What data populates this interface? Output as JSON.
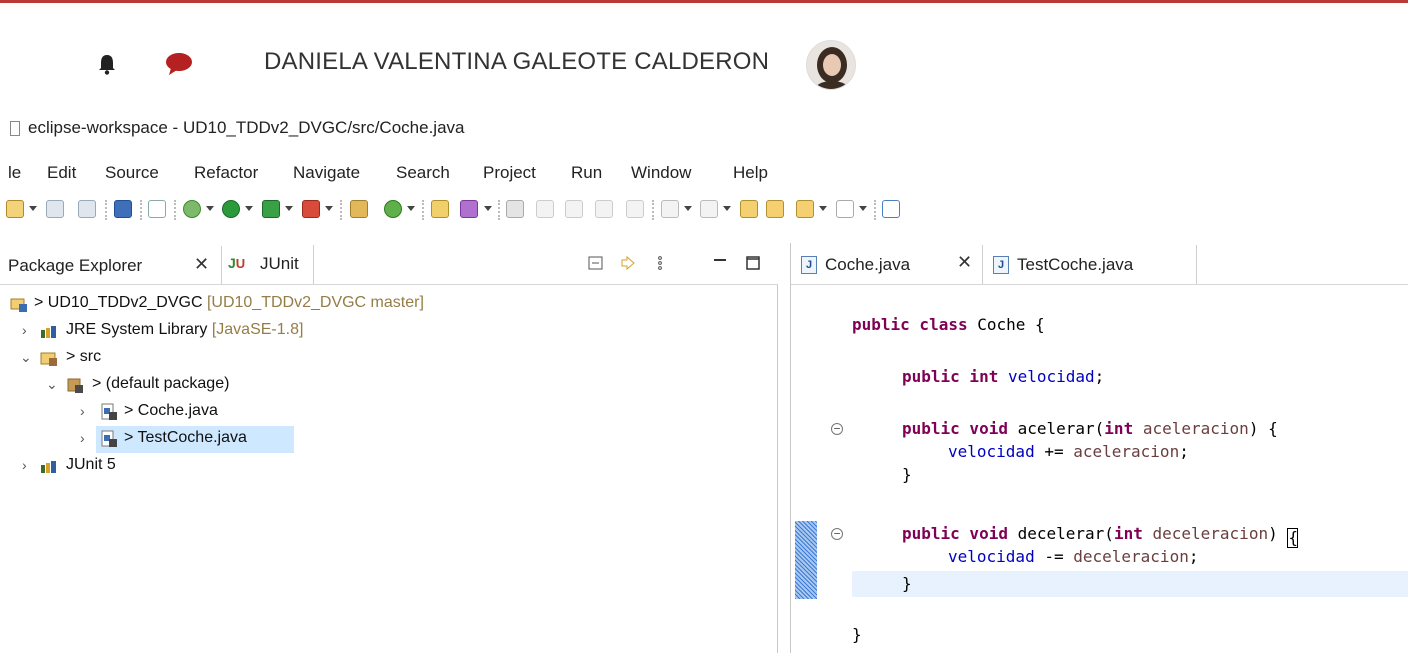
{
  "topbar": {
    "user_name": "DANIELA VALENTINA GALEOTE CALDERON",
    "accent": "#b93a36"
  },
  "window": {
    "title": "eclipse-workspace - UD10_TDDv2_DVGC/src/Coche.java"
  },
  "menu": {
    "items": [
      "le",
      "Edit",
      "Source",
      "Refactor",
      "Navigate",
      "Search",
      "Project",
      "Run",
      "Window",
      "Help"
    ]
  },
  "left_panel": {
    "tabs": [
      {
        "label": "Package Explorer",
        "close": "✕"
      },
      {
        "label": "JUnit"
      }
    ],
    "tree": [
      {
        "label": "> UD10_TDDv2_DVGC",
        "decoration": "[UD10_TDDv2_DVGC master]",
        "icon": "project-icon"
      },
      {
        "label": "JRE System Library",
        "decoration": "[JavaSE-1.8]",
        "icon": "library-icon"
      },
      {
        "label": "> src",
        "icon": "source-folder-icon"
      },
      {
        "label": "> (default package)",
        "icon": "package-icon"
      },
      {
        "label": "> Coche.java",
        "icon": "java-file-icon"
      },
      {
        "label": "> TestCoche.java",
        "icon": "java-file-icon",
        "selected": true
      },
      {
        "label": "JUnit 5",
        "icon": "library-icon"
      }
    ]
  },
  "editor": {
    "tabs": [
      {
        "label": "Coche.java",
        "close": "✕",
        "active": true
      },
      {
        "label": "TestCoche.java"
      }
    ],
    "code": {
      "l1_kw": "public class",
      "l1_rest": " Coche {",
      "l2_kw": "public int",
      "l2_field": "velocidad",
      "l2_end": ";",
      "l3_kw1": "public void",
      "l3_name": " acelerar(",
      "l3_kw2": "int",
      "l3_param": "aceleracion",
      "l3_end": ") {",
      "l4_field": "velocidad",
      "l4_op": " += ",
      "l4_param": "aceleracion",
      "l4_end": ";",
      "l5": "}",
      "l6_kw1": "public void",
      "l6_name": " decelerar(",
      "l6_kw2": "int",
      "l6_param": "deceleracion",
      "l6_end": ") ",
      "l6_bracket": "{",
      "l7_field": "velocidad",
      "l7_op": " -= ",
      "l7_param": "deceleracion",
      "l7_end": ";",
      "l8": "}",
      "l9": "}"
    }
  }
}
